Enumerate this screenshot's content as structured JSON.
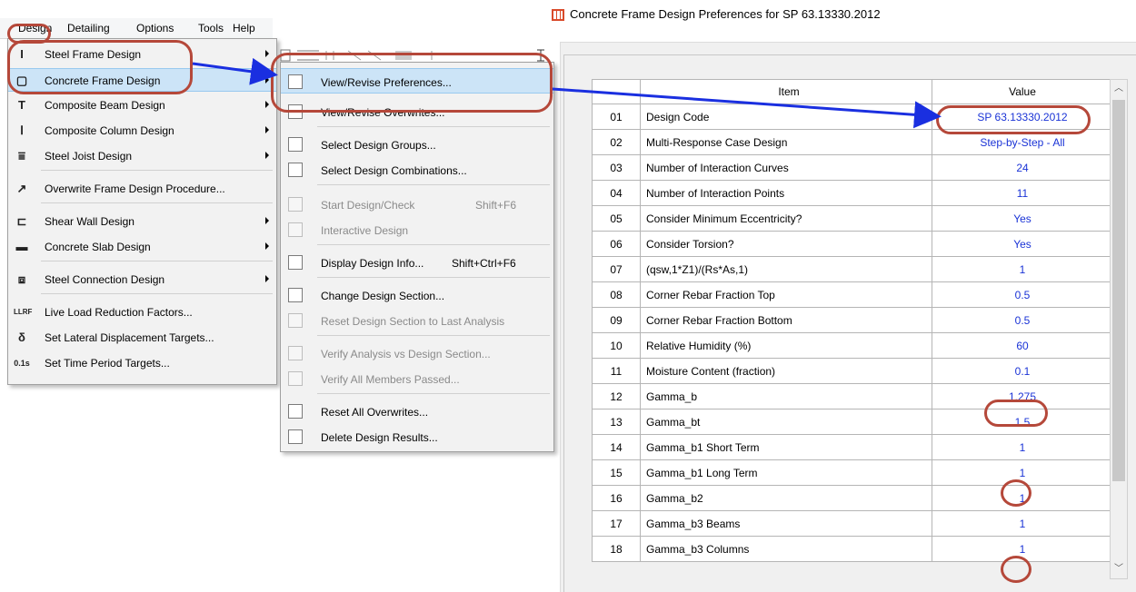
{
  "menubar": {
    "items": [
      {
        "label": "Design"
      },
      {
        "label": "Detailing"
      },
      {
        "label": "Options"
      },
      {
        "label": "Tools"
      },
      {
        "label": "Help"
      }
    ]
  },
  "design_menu": {
    "items": [
      {
        "label": "Steel Frame Design",
        "icon": "steel-frame-icon",
        "submenu": true
      },
      {
        "label": "Concrete Frame Design",
        "icon": "concrete-frame-icon",
        "submenu": true,
        "highlighted": true
      },
      {
        "label": "Composite Beam Design",
        "icon": "composite-beam-icon",
        "submenu": true
      },
      {
        "label": "Composite Column Design",
        "icon": "composite-column-icon",
        "submenu": true
      },
      {
        "label": "Steel Joist Design",
        "icon": "steel-joist-icon",
        "submenu": true
      },
      {
        "label": "Overwrite Frame Design Procedure...",
        "icon": "overwrite-procedure-icon",
        "submenu": false
      },
      {
        "label": "Shear Wall Design",
        "icon": "shear-wall-icon",
        "submenu": true
      },
      {
        "label": "Concrete Slab Design",
        "icon": "concrete-slab-icon",
        "submenu": true
      },
      {
        "label": "Steel Connection Design",
        "icon": "steel-connection-icon",
        "submenu": true
      },
      {
        "label": "Live Load Reduction Factors...",
        "icon": "live-load-reduction-icon",
        "submenu": false
      },
      {
        "label": "Set Lateral Displacement Targets...",
        "icon": "lateral-displacement-icon",
        "submenu": false
      },
      {
        "label": "Set Time Period Targets...",
        "icon": "time-period-icon",
        "submenu": false
      }
    ]
  },
  "concrete_submenu": {
    "items": [
      {
        "label": "View/Revise Preferences...",
        "shortcut": "",
        "enabled": true,
        "highlighted": true
      },
      {
        "label": "View/Revise Overwrites...",
        "shortcut": "",
        "enabled": true
      },
      {
        "label": "Select Design Groups...",
        "shortcut": "",
        "enabled": true
      },
      {
        "label": "Select Design Combinations...",
        "shortcut": "",
        "enabled": true
      },
      {
        "label": "Start Design/Check",
        "shortcut": "Shift+F6",
        "enabled": false
      },
      {
        "label": "Interactive Design",
        "shortcut": "",
        "enabled": false
      },
      {
        "label": "Display Design Info...",
        "shortcut": "Shift+Ctrl+F6",
        "enabled": true
      },
      {
        "label": "Change Design Section...",
        "shortcut": "",
        "enabled": true
      },
      {
        "label": "Reset Design Section to Last Analysis",
        "shortcut": "",
        "enabled": false
      },
      {
        "label": "Verify Analysis vs Design Section...",
        "shortcut": "",
        "enabled": false
      },
      {
        "label": "Verify All Members Passed...",
        "shortcut": "",
        "enabled": false
      },
      {
        "label": "Reset All Overwrites...",
        "shortcut": "",
        "enabled": true
      },
      {
        "label": "Delete Design Results...",
        "shortcut": "",
        "enabled": true
      }
    ]
  },
  "dialog": {
    "title": "Concrete Frame Design Preferences for SP 63.13330.2012",
    "table": {
      "headers": {
        "item": "Item",
        "value": "Value"
      },
      "rows": [
        {
          "num": "01",
          "item": "Design Code",
          "value": "SP 63.13330.2012"
        },
        {
          "num": "02",
          "item": "Multi-Response Case Design",
          "value": "Step-by-Step - All"
        },
        {
          "num": "03",
          "item": "Number of Interaction Curves",
          "value": "24"
        },
        {
          "num": "04",
          "item": "Number of Interaction Points",
          "value": "11"
        },
        {
          "num": "05",
          "item": "Consider Minimum Eccentricity?",
          "value": "Yes"
        },
        {
          "num": "06",
          "item": "Consider Torsion?",
          "value": "Yes"
        },
        {
          "num": "07",
          "item": "(qsw,1*Z1)/(Rs*As,1)",
          "value": "1"
        },
        {
          "num": "08",
          "item": "Corner Rebar Fraction Top",
          "value": "0.5"
        },
        {
          "num": "09",
          "item": "Corner Rebar Fraction Bottom",
          "value": "0.5"
        },
        {
          "num": "10",
          "item": "Relative Humidity (%)",
          "value": "60"
        },
        {
          "num": "11",
          "item": "Moisture Content (fraction)",
          "value": "0.1"
        },
        {
          "num": "12",
          "item": "Gamma_b",
          "value": "1.275"
        },
        {
          "num": "13",
          "item": "Gamma_bt",
          "value": "1.5"
        },
        {
          "num": "14",
          "item": "Gamma_b1 Short Term",
          "value": "1"
        },
        {
          "num": "15",
          "item": "Gamma_b1 Long Term",
          "value": "1"
        },
        {
          "num": "16",
          "item": "Gamma_b2",
          "value": "1"
        },
        {
          "num": "17",
          "item": "Gamma_b3 Beams",
          "value": "1"
        },
        {
          "num": "18",
          "item": "Gamma_b3 Columns",
          "value": "1"
        }
      ]
    }
  },
  "colors": {
    "highlight": "#cce4f7",
    "annotation": "#b5483a",
    "arrow": "#1a2fe0",
    "value_text": "#1a33d6"
  }
}
